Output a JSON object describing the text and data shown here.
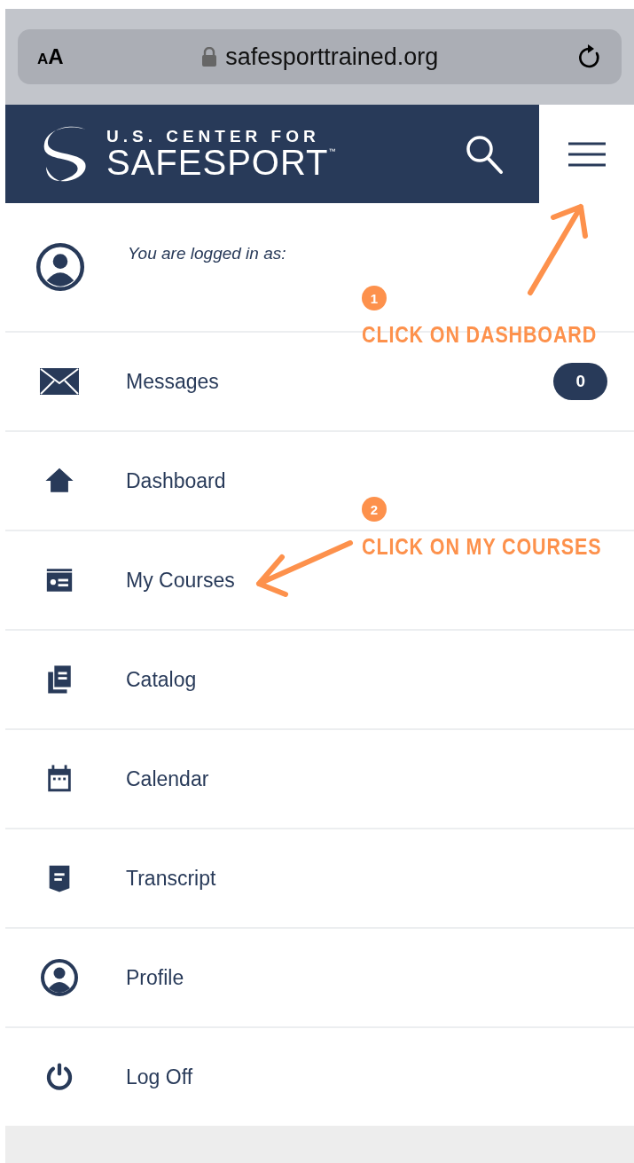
{
  "browser": {
    "text_size_button": "AA",
    "url": "safesporttrained.org"
  },
  "header": {
    "logo_top": "U.S. CENTER FOR",
    "logo_bottom": "SAFESPORT",
    "logo_mark": "™"
  },
  "account": {
    "label": "You are logged in as:"
  },
  "menu": [
    {
      "label": "Messages",
      "badge": "0"
    },
    {
      "label": "Dashboard"
    },
    {
      "label": "My Courses"
    },
    {
      "label": "Catalog"
    },
    {
      "label": "Calendar"
    },
    {
      "label": "Transcript"
    },
    {
      "label": "Profile"
    },
    {
      "label": "Log Off"
    }
  ],
  "annotations": [
    {
      "number": "1",
      "text": "CLICK ON DASHBOARD"
    },
    {
      "number": "2",
      "text": "CLICK ON MY COURSES"
    }
  ]
}
